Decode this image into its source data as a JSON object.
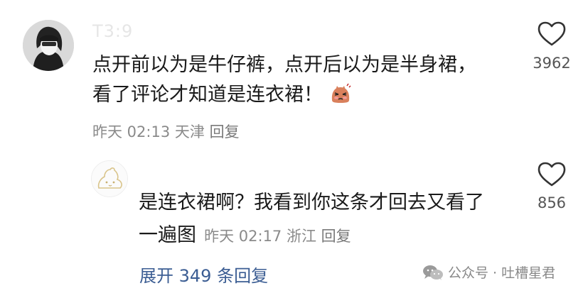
{
  "main_comment": {
    "username": "T3:9",
    "text_line1": "点开前以为是牛仔裤，点开后以为是半身裙，",
    "text_line2": "看了评论才知道是连衣裙！",
    "emoji": "flushed-cat-emoji",
    "time": "昨天 02:13",
    "location": "天津",
    "reply_label": "回复",
    "likes": "3962"
  },
  "reply_comment": {
    "text_line1": "是连衣裙啊？我看到你这条才回去又看了",
    "text_line2": "一遍图",
    "time": "昨天 02:17",
    "location": "浙江",
    "reply_label": "回复",
    "likes": "856"
  },
  "expand_label": "展开 349 条回复",
  "watermark": {
    "text": "公众号 · 吐槽星君"
  },
  "colors": {
    "text": "#1a1a1a",
    "meta": "#8a8a8a",
    "link": "#3b5d93"
  }
}
